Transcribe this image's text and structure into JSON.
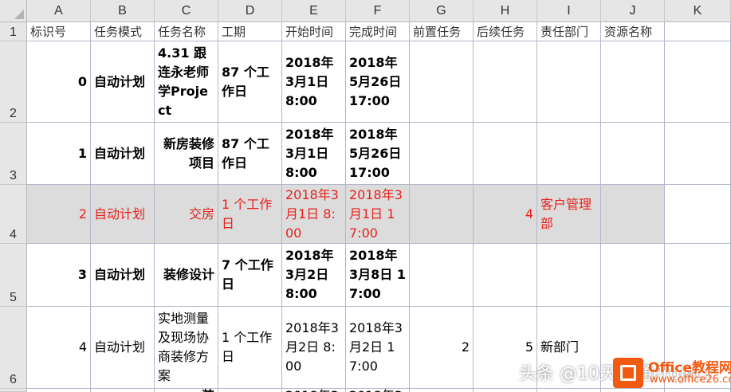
{
  "columns": [
    "A",
    "B",
    "C",
    "D",
    "E",
    "F",
    "G",
    "H",
    "I",
    "J",
    "K"
  ],
  "rows": [
    "1",
    "2",
    "3",
    "4",
    "5",
    "6"
  ],
  "header_row": [
    "标识号",
    "任务模式",
    "任务名称",
    "工期",
    "开始时间",
    "完成时间",
    "前置任务",
    "后续任务",
    "责任部门",
    "资源名称",
    ""
  ],
  "data_rows": [
    [
      "0",
      "自动计划",
      "4.31 跟连永老师学Project",
      "87 个工作日",
      "2018年3月1日 8:00",
      "2018年5月26日 17:00",
      "",
      "",
      "",
      ""
    ],
    [
      "1",
      "自动计划",
      "新房装修项目",
      "87 个工作日",
      "2018年3月1日 8:00",
      "2018年5月26日 17:00",
      "",
      "",
      "",
      ""
    ],
    [
      "2",
      "自动计划",
      "交房",
      "1 个工作日",
      "2018年3月1日 8:00",
      "2018年3月1日 17:00",
      "",
      "4",
      "客户管理部",
      ""
    ],
    [
      "3",
      "自动计划",
      "装修设计",
      "7 个工作日",
      "2018年3月2日 8:00",
      "2018年3月8日 17:00",
      "",
      "",
      "",
      ""
    ],
    [
      "4",
      "自动计划",
      "实地测量及现场协商装修方案",
      "1 个工作日",
      "2018年3月2日 8:00",
      "2018年3月2日 17:00",
      "2",
      "5",
      "新部门",
      ""
    ]
  ],
  "partial_row": [
    "",
    "",
    "装",
    "",
    "2018年3",
    "2018年3",
    "",
    "",
    "",
    ""
  ],
  "colors": {
    "highlight_text": "#e8201c",
    "highlight_fill": "#dcdcdc",
    "grid_header": "#e6e6e6"
  },
  "watermark": {
    "text": "头条 @10天精通Project",
    "brand": "Office教程网",
    "url": "www.office26.com"
  }
}
